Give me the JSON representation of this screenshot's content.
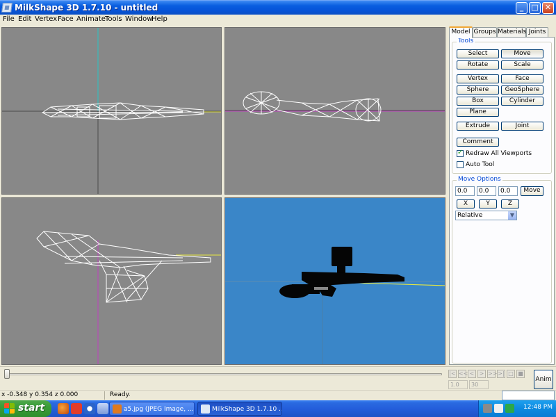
{
  "window": {
    "title": "MilkShape 3D 1.7.10 - untitled",
    "min": "_",
    "max": "□",
    "close": "✕"
  },
  "menu": [
    "File",
    "Edit",
    "Vertex",
    "Face",
    "Animate",
    "Tools",
    "Window",
    "Help"
  ],
  "tabs": [
    "Model",
    "Groups",
    "Materials",
    "Joints"
  ],
  "tools": {
    "title": "Tools",
    "select": "Select",
    "move": "Move",
    "rotate": "Rotate",
    "scale": "Scale",
    "vertex": "Vertex",
    "face": "Face",
    "sphere": "Sphere",
    "geosphere": "GeoSphere",
    "box": "Box",
    "cylinder": "Cylinder",
    "plane": "Plane",
    "extrude": "Extrude",
    "joint": "Joint",
    "comment": "Comment",
    "redraw_label": "Redraw All Viewports",
    "redraw_checked": true,
    "autotool_label": "Auto Tool",
    "autotool_checked": false
  },
  "move_options": {
    "title": "Move Options",
    "x_value": "0.0",
    "y_value": "0.0",
    "z_value": "0.0",
    "move_button": "Move",
    "axis_x": "X",
    "axis_y": "Y",
    "axis_z": "Z",
    "mode": "Relative"
  },
  "timeline": {
    "position": 0,
    "frame_start": "1.0",
    "frame_count": "30",
    "anim_button": "Anim",
    "buttons": [
      "|<",
      "<<",
      "<",
      ">",
      ">>",
      ">|"
    ]
  },
  "status": {
    "coords": "x -0.348 y 0.354 z 0.000",
    "message": "Ready."
  },
  "taskbar": {
    "start": "start",
    "tasks": [
      {
        "label": "a5.jpg (JPEG Image, ...",
        "active": false,
        "icon_color": "#e07a1f"
      },
      {
        "label": "MilkShape 3D 1.7.10 ...",
        "active": true,
        "icon_color": "#dfe8f5"
      }
    ],
    "clock": "12:48 PM"
  },
  "colors": {
    "viewport_bg": "#888888",
    "render_bg": "#3a86c8",
    "axis_green": "#26c6c6",
    "axis_magenta": "#c040c0",
    "axis_yellow": "#e8e840"
  }
}
